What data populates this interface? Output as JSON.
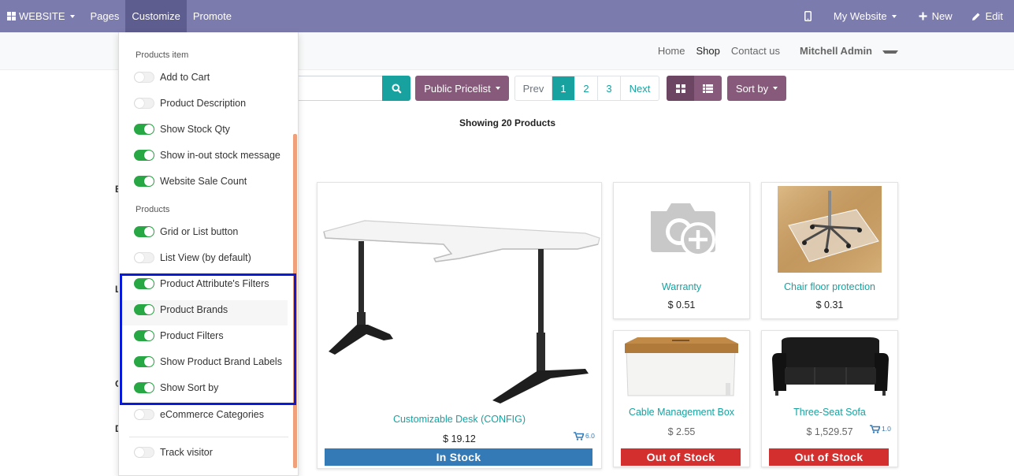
{
  "topbar": {
    "apps_label": "WEBSITE",
    "menu": [
      "Pages",
      "Customize",
      "Promote"
    ],
    "mobile_icon": "mobile-icon",
    "website_label": "My Website",
    "new_label": "New",
    "edit_label": "Edit"
  },
  "sitenav": {
    "items": [
      "Home",
      "Shop",
      "Contact us"
    ],
    "user": "Mitchell Admin"
  },
  "toolbar": {
    "pricelist": "Public Pricelist",
    "pager": {
      "prev": "Prev",
      "pages": [
        "1",
        "2",
        "3"
      ],
      "next": "Next",
      "current": "1"
    },
    "sort_by": "Sort by",
    "showing": "Showing 20 Products"
  },
  "left_stubs": [
    "B",
    "L",
    "C",
    "D"
  ],
  "customize_panel": {
    "section_items": "Products item",
    "items_options": [
      {
        "label": "Add to Cart",
        "on": false
      },
      {
        "label": "Product Description",
        "on": false
      },
      {
        "label": "Show Stock Qty",
        "on": true
      },
      {
        "label": "Show in-out stock message",
        "on": true
      },
      {
        "label": "Website Sale Count",
        "on": true
      }
    ],
    "section_products": "Products",
    "products_options": [
      {
        "label": "Grid or List button",
        "on": true
      },
      {
        "label": "List View (by default)",
        "on": false
      },
      {
        "label": "Product Attribute's Filters",
        "on": true
      },
      {
        "label": "Product Brands",
        "on": true
      },
      {
        "label": "Product Filters",
        "on": true
      },
      {
        "label": "Show Product Brand Labels",
        "on": true
      },
      {
        "label": "Show Sort by",
        "on": true
      },
      {
        "label": "eCommerce Categories",
        "on": false
      }
    ],
    "extra_options": [
      {
        "label": "Track visitor",
        "on": false
      }
    ]
  },
  "products": [
    {
      "name": "Customizable Desk (CONFIG)",
      "price": "$ 19.12",
      "cart_count": "6.0",
      "stock": "In Stock"
    },
    {
      "name": "Warranty",
      "price": "$ 0.51"
    },
    {
      "name": "Chair floor protection",
      "price": "$ 0.31"
    },
    {
      "name": "Cable Management Box",
      "price": "$ 2.55",
      "stock": "Out of Stock"
    },
    {
      "name": "Three-Seat Sofa",
      "price": "$ 1,529.57",
      "cart_count": "1.0",
      "stock": "Out of Stock"
    }
  ],
  "colors": {
    "topbar": "#7c7bad",
    "accent": "#17a2a0",
    "brand": "#875a7b",
    "in_stock": "#337ab7",
    "out_of_stock": "#d32f2f",
    "highlight_box": "#0a1bd8"
  }
}
